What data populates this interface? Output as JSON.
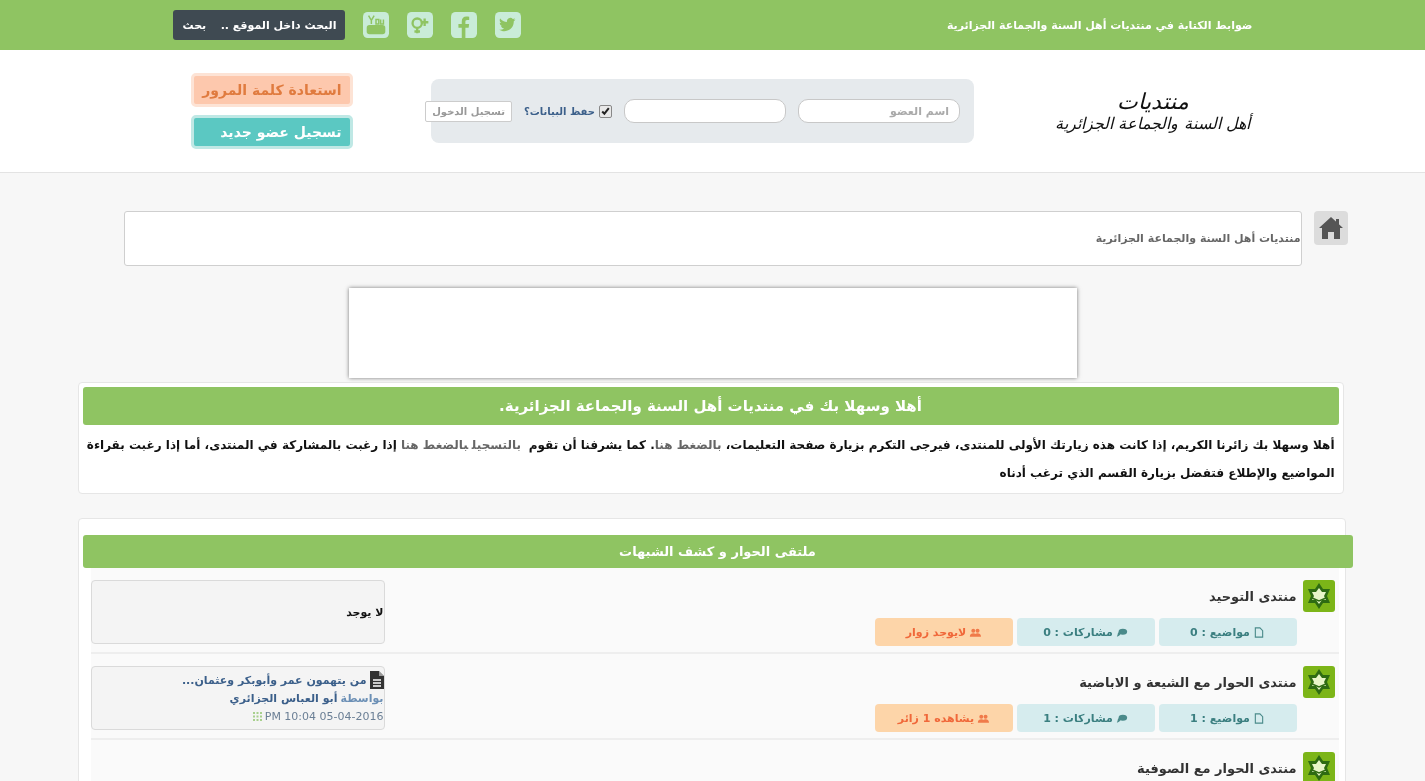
{
  "topbar": {
    "notice": "ضوابط الكتابة في منتديات أهل السنة والجماعة الجزائرية",
    "search": {
      "placeholder": "البحث داخل الموقع ..",
      "button": "بحث"
    }
  },
  "logo": {
    "line_1": "منتديات",
    "line_2": "أهل السنة والجماعة الجزائرية"
  },
  "login": {
    "username_placeholder": "اسم العضو",
    "remember": {
      "label": "حفظ البيانات؟",
      "checked": true
    },
    "button": "تسجيل الدخول"
  },
  "account_buttons": [
    "استعادة كلمة المرور",
    "تسجيل عضو جديد"
  ],
  "breadcrumb": "منتديات أهل السنة والجماعة الجزائرية",
  "welcome": {
    "title": "أهلا وسهلا بك في منتديات أهل السنة والجماعة الجزائرية.",
    "segments": [
      {
        "kind": "text",
        "text": "أهلا وسهلا بك زائرنا الكريم، إذا كانت هذه زيارتك الأولى للمنتدى، فيرجى التكرم بزيارة صفحة التعليمات، "
      },
      {
        "kind": "link",
        "text": "بالضغط هنا"
      },
      {
        "kind": "text",
        "text": ". كما يشرفنا أن تقوم "
      },
      {
        "kind": "link",
        "text": "بالتسجيل"
      },
      {
        "kind": "link",
        "text": "بالضغط هنا"
      },
      {
        "kind": "text",
        "text": " إذا رغبت بالمشاركة في المنتدى، أما إذا رغبت بقراءة المواضيع والإطلاع فتفضل بزيارة القسم الذي ترغب أدناه"
      }
    ]
  },
  "category": {
    "title": "ملتقى الحوار و كشف الشبهات",
    "forums": [
      {
        "title": "منتدى التوحيد",
        "topics": "مواضيع : 0",
        "posts": "مشاركات : 0",
        "visitors": "لايوجد زوار",
        "last_post": {
          "kind": "none",
          "text": "لا يوجد"
        }
      },
      {
        "title": "منتدى الحوار مع الشيعة و الاباضية",
        "topics": "مواضيع : 1",
        "posts": "مشاركات : 1",
        "visitors": "يشاهده 1 زائر",
        "last_post": {
          "kind": "post",
          "title": "من يتهمون عمر وأبوبكر وعثمان...",
          "by": "بواسطة",
          "author": "أبو العباس الجزائري",
          "date": "PM 10:04 05-04-2016"
        }
      },
      {
        "title": "منتدى الحوار مع الصوفية"
      }
    ]
  }
}
